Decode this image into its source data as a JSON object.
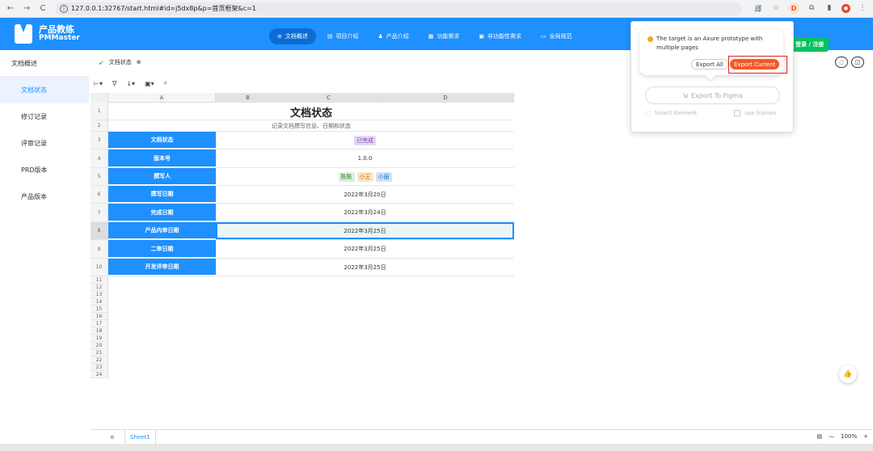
{
  "browser": {
    "url": "127.0.0.1:32767/start.html#id=j5dx8p&p=首页框架&c=1",
    "back": "←",
    "forward": "→",
    "reload": "C",
    "profile_letter": "D"
  },
  "header": {
    "logo_cn": "产品教练",
    "logo_en": "PMMaster",
    "nav": [
      {
        "label": "文档概述"
      },
      {
        "label": "项目介绍"
      },
      {
        "label": "产品介绍"
      },
      {
        "label": "功能需求"
      },
      {
        "label": "非功能性需求"
      },
      {
        "label": "全局规范"
      }
    ],
    "login_label": "登录 / 注册"
  },
  "sidebar": {
    "header": "文档概述",
    "items": [
      {
        "label": "文档状态"
      },
      {
        "label": "修订记录"
      },
      {
        "label": "评审记录"
      },
      {
        "label": "PRD版本"
      },
      {
        "label": "产品版本"
      }
    ]
  },
  "doc": {
    "title": "文档状态"
  },
  "sheet": {
    "columns": [
      "A",
      "B",
      "C",
      "D"
    ],
    "title": "文档状态",
    "subtitle": "记录文档撰写信息、日期和状态",
    "rows": [
      {
        "label": "文档状态",
        "value": "已完成"
      },
      {
        "label": "版本号",
        "value": "1.0.0"
      },
      {
        "label": "撰写人",
        "tags": [
          "陈陈",
          "小王",
          "小丽"
        ]
      },
      {
        "label": "撰写日期",
        "value": "2022年3月20日"
      },
      {
        "label": "完成日期",
        "value": "2022年3月24日"
      },
      {
        "label": "产品内审日期",
        "value": "2022年3月25日"
      },
      {
        "label": "二审日期",
        "value": "2022年3月25日"
      },
      {
        "label": "开发评审日期",
        "value": "2022年3月25日"
      }
    ],
    "row_numbers": [
      "1",
      "2",
      "3",
      "4",
      "5",
      "6",
      "7",
      "8",
      "9",
      "10",
      "11",
      "12",
      "13",
      "14",
      "15",
      "16",
      "17",
      "18",
      "19",
      "20",
      "21",
      "22",
      "23",
      "24"
    ],
    "tab_name": "Sheet1",
    "zoom": "100%"
  },
  "popup": {
    "message": "The target is an Axure prototype with multiple pages",
    "export_all": "Export All",
    "export_current": "Export Current",
    "export_figma": "Export To Figma",
    "select_element": "Select Element",
    "use_frames": "use frames"
  },
  "colors": {
    "brand": "#1e90ff",
    "login": "#07c160",
    "export_current": "#f05a28",
    "highlight": "#e02020"
  }
}
